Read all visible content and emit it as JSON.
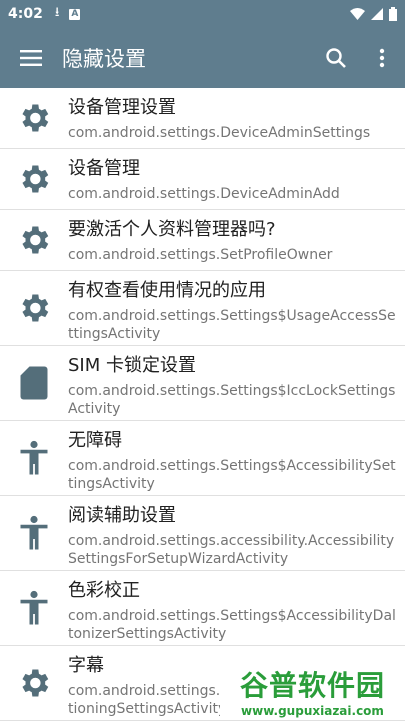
{
  "status": {
    "time": "4:02",
    "badge": "A"
  },
  "toolbar": {
    "title": "隐藏设置"
  },
  "items": [
    {
      "title": "设备管理设置",
      "subtitle": "com.android.settings.DeviceAdminSettings",
      "icon": "gear-icon"
    },
    {
      "title": "设备管理",
      "subtitle": "com.android.settings.DeviceAdminAdd",
      "icon": "gear-icon"
    },
    {
      "title": "要激活个人资料管理器吗?",
      "subtitle": "com.android.settings.SetProfileOwner",
      "icon": "gear-icon"
    },
    {
      "title": "有权查看使用情况的应用",
      "subtitle": "com.android.settings.Settings$UsageAccessSettingsActivity",
      "icon": "gear-icon"
    },
    {
      "title": "SIM 卡锁定设置",
      "subtitle": "com.android.settings.Settings$IccLockSettingsActivity",
      "icon": "sim-card-icon"
    },
    {
      "title": "无障碍",
      "subtitle": "com.android.settings.Settings$AccessibilitySettingsActivity",
      "icon": "accessibility-icon"
    },
    {
      "title": "阅读辅助设置",
      "subtitle": "com.android.settings.accessibility.AccessibilitySettingsForSetupWizardActivity",
      "icon": "accessibility-icon"
    },
    {
      "title": "色彩校正",
      "subtitle": "com.android.settings.Settings$AccessibilityDaltonizerSettingsActivity",
      "icon": "accessibility-icon"
    },
    {
      "title": "字幕",
      "subtitle": "com.android.settings.Settings$AccessibilityCaptioningSettingsActivity",
      "icon": "gear-icon"
    }
  ],
  "watermark": {
    "line1": "谷普软件园",
    "line2": "www.gupuxiazai.com"
  },
  "colors": {
    "toolbar": "#5f7d8e",
    "icon": "#546e7a"
  }
}
